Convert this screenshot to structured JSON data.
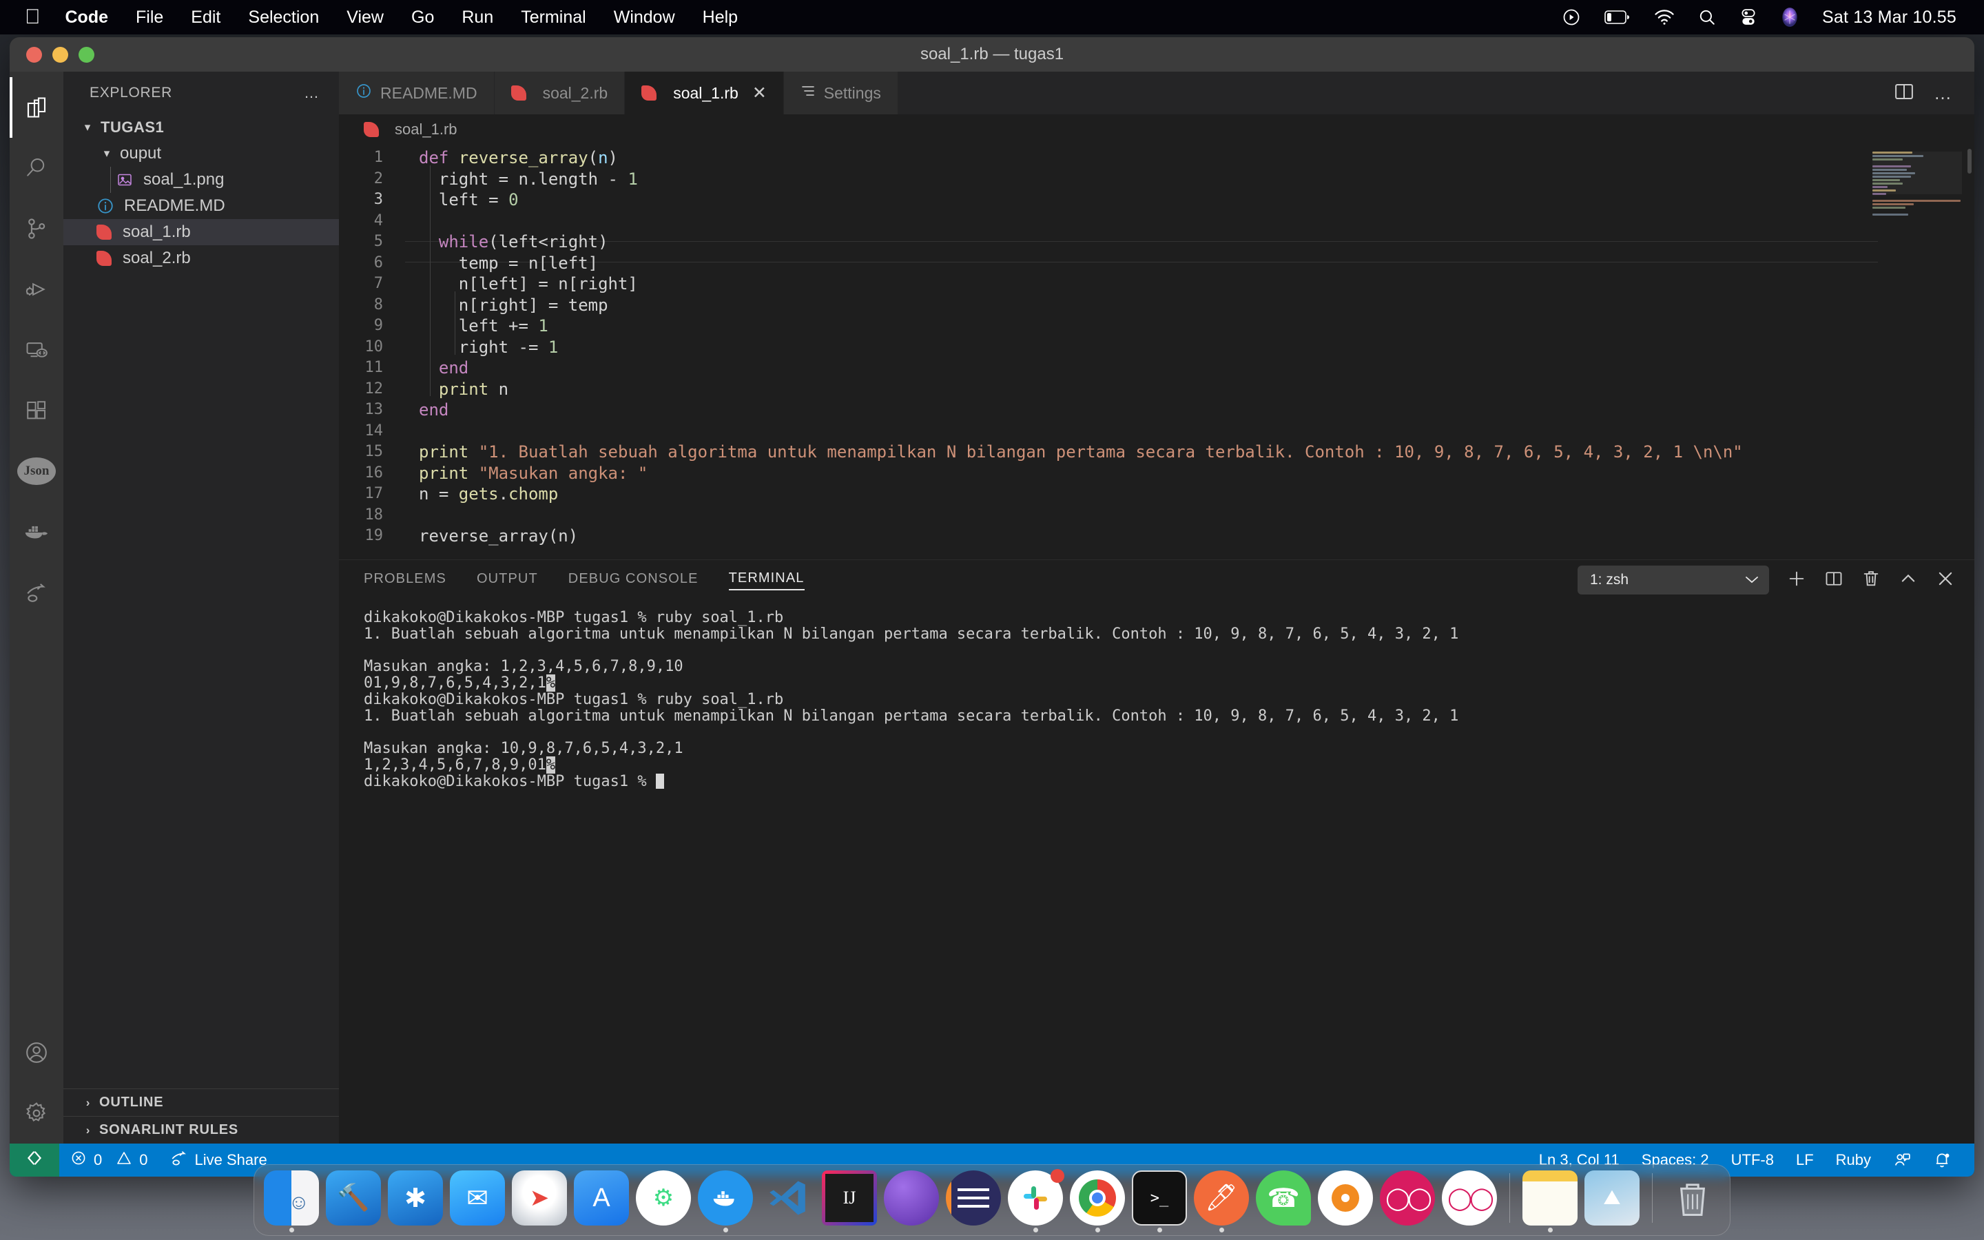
{
  "menubar": {
    "apple_icon": "apple-logo-icon",
    "items": [
      {
        "label": "Code",
        "bold": true
      },
      {
        "label": "File",
        "bold": false
      },
      {
        "label": "Edit",
        "bold": false
      },
      {
        "label": "Selection",
        "bold": false
      },
      {
        "label": "View",
        "bold": false
      },
      {
        "label": "Go",
        "bold": false
      },
      {
        "label": "Run",
        "bold": false
      },
      {
        "label": "Terminal",
        "bold": false
      },
      {
        "label": "Window",
        "bold": false
      },
      {
        "label": "Help",
        "bold": false
      }
    ],
    "status_icons": [
      "screen-record-icon",
      "battery-icon",
      "wifi-icon",
      "search-icon",
      "control-center-icon",
      "siri-icon"
    ],
    "clock": "Sat 13 Mar  10.55"
  },
  "window": {
    "title": "soal_1.rb — tugas1",
    "traffic_lights": [
      "close-button",
      "minimize-button",
      "zoom-button"
    ]
  },
  "activitybar": {
    "items": [
      {
        "name": "explorer",
        "icon": "files-icon",
        "active": true
      },
      {
        "name": "search",
        "icon": "search-icon",
        "active": false
      },
      {
        "name": "source-control",
        "icon": "source-control-icon",
        "active": false
      },
      {
        "name": "run-and-debug",
        "icon": "run-debug-icon",
        "active": false
      },
      {
        "name": "remote-explorer",
        "icon": "remote-monitor-icon",
        "active": false
      },
      {
        "name": "extensions",
        "icon": "extensions-icon",
        "active": false
      },
      {
        "name": "json-tools",
        "icon": "json-icon",
        "label": "Json",
        "active": false
      },
      {
        "name": "docker",
        "icon": "docker-whale-icon",
        "active": false
      },
      {
        "name": "live-share",
        "icon": "live-share-icon",
        "active": false
      }
    ],
    "bottom_items": [
      {
        "name": "accounts",
        "icon": "account-icon"
      },
      {
        "name": "manage",
        "icon": "gear-icon"
      }
    ]
  },
  "sidebar": {
    "title": "EXPLORER",
    "more_actions": "…",
    "tree": [
      {
        "label": "TUGAS1",
        "type": "root",
        "chevron": "▾",
        "indent": 0,
        "selected": false
      },
      {
        "label": "ouput",
        "type": "folder",
        "chevron": "▾",
        "indent": 1,
        "selected": false
      },
      {
        "label": "soal_1.png",
        "type": "image",
        "chevron": "",
        "indent": 2,
        "selected": false
      },
      {
        "label": "README.MD",
        "type": "markdown",
        "chevron": "",
        "indent": 1,
        "selected": false
      },
      {
        "label": "soal_1.rb",
        "type": "ruby",
        "chevron": "",
        "indent": 1,
        "selected": true
      },
      {
        "label": "soal_2.rb",
        "type": "ruby",
        "chevron": "",
        "indent": 1,
        "selected": false
      }
    ],
    "sections": [
      {
        "label": "OUTLINE",
        "chevron": "›"
      },
      {
        "label": "SONARLINT RULES",
        "chevron": "›"
      }
    ]
  },
  "editor": {
    "tabs": [
      {
        "label": "README.MD",
        "icon": "markdown-info-icon",
        "active": false,
        "closable": false
      },
      {
        "label": "soal_2.rb",
        "icon": "ruby-icon",
        "active": false,
        "closable": false
      },
      {
        "label": "soal_1.rb",
        "icon": "ruby-icon",
        "active": true,
        "closable": true,
        "close_glyph": "✕"
      },
      {
        "label": "Settings",
        "icon": "settings-lines-icon",
        "active": false,
        "closable": false
      }
    ],
    "actions": [
      "split-editor-icon",
      "more-actions-icon"
    ],
    "breadcrumb": "soal_1.rb",
    "language": "ruby",
    "lines": [
      {
        "n": 1,
        "indent": 0,
        "tokens": [
          {
            "t": "def ",
            "c": "kw"
          },
          {
            "t": "reverse_array",
            "c": "fn"
          },
          {
            "t": "(",
            "c": "pl"
          },
          {
            "t": "n",
            "c": "param"
          },
          {
            "t": ")",
            "c": "pl"
          }
        ]
      },
      {
        "n": 2,
        "indent": 1,
        "tokens": [
          {
            "t": "right = n.length ",
            "c": "pl"
          },
          {
            "t": "- ",
            "c": "pl"
          },
          {
            "t": "1",
            "c": "num"
          }
        ]
      },
      {
        "n": 3,
        "indent": 1,
        "current": true,
        "tokens": [
          {
            "t": "left = ",
            "c": "pl"
          },
          {
            "t": "0",
            "c": "num"
          }
        ]
      },
      {
        "n": 4,
        "indent": 0,
        "tokens": []
      },
      {
        "n": 5,
        "indent": 1,
        "tokens": [
          {
            "t": "while",
            "c": "kw"
          },
          {
            "t": "(left<right)",
            "c": "pl"
          }
        ]
      },
      {
        "n": 6,
        "indent": 2,
        "tokens": [
          {
            "t": "temp = n[left]",
            "c": "pl"
          }
        ]
      },
      {
        "n": 7,
        "indent": 2,
        "tokens": [
          {
            "t": "n[left] = n[right]",
            "c": "pl"
          }
        ]
      },
      {
        "n": 8,
        "indent": 2,
        "tokens": [
          {
            "t": "n[right] = temp",
            "c": "pl"
          }
        ]
      },
      {
        "n": 9,
        "indent": 2,
        "tokens": [
          {
            "t": "left += ",
            "c": "pl"
          },
          {
            "t": "1",
            "c": "num"
          }
        ]
      },
      {
        "n": 10,
        "indent": 2,
        "tokens": [
          {
            "t": "right -= ",
            "c": "pl"
          },
          {
            "t": "1",
            "c": "num"
          }
        ]
      },
      {
        "n": 11,
        "indent": 1,
        "tokens": [
          {
            "t": "end",
            "c": "kw"
          }
        ]
      },
      {
        "n": 12,
        "indent": 1,
        "tokens": [
          {
            "t": "print",
            "c": "fn"
          },
          {
            "t": " n",
            "c": "pl"
          }
        ]
      },
      {
        "n": 13,
        "indent": 0,
        "tokens": [
          {
            "t": "end",
            "c": "kw"
          }
        ]
      },
      {
        "n": 14,
        "indent": 0,
        "tokens": []
      },
      {
        "n": 15,
        "indent": 0,
        "tokens": [
          {
            "t": "print",
            "c": "fn"
          },
          {
            "t": " ",
            "c": "pl"
          },
          {
            "t": "\"1. Buatlah sebuah algoritma untuk menampilkan N bilangan pertama secara terbalik. Contoh : 10, 9, 8, 7, 6, 5, 4, 3, 2, 1 \\n\\n\"",
            "c": "str"
          }
        ]
      },
      {
        "n": 16,
        "indent": 0,
        "tokens": [
          {
            "t": "print",
            "c": "fn"
          },
          {
            "t": " ",
            "c": "pl"
          },
          {
            "t": "\"Masukan angka: \"",
            "c": "str"
          }
        ]
      },
      {
        "n": 17,
        "indent": 0,
        "tokens": [
          {
            "t": "n = ",
            "c": "pl"
          },
          {
            "t": "gets",
            "c": "fn"
          },
          {
            "t": ".",
            "c": "pl"
          },
          {
            "t": "chomp",
            "c": "fn"
          }
        ]
      },
      {
        "n": 18,
        "indent": 0,
        "tokens": []
      },
      {
        "n": 19,
        "indent": 0,
        "tokens": [
          {
            "t": "reverse_array(n)",
            "c": "pl"
          }
        ]
      }
    ]
  },
  "panel": {
    "tabs": [
      {
        "label": "PROBLEMS",
        "active": false
      },
      {
        "label": "OUTPUT",
        "active": false
      },
      {
        "label": "DEBUG CONSOLE",
        "active": false
      },
      {
        "label": "TERMINAL",
        "active": true
      }
    ],
    "shell_selector": {
      "value": "1: zsh",
      "chevron": "⌄"
    },
    "actions": [
      "new-terminal-icon",
      "split-terminal-icon",
      "kill-terminal-icon",
      "maximize-panel-icon",
      "close-panel-icon"
    ],
    "terminal_lines": [
      {
        "text": "dikakoko@Dikakokos-MBP tugas1 % ruby soal_1.rb"
      },
      {
        "text": "1. Buatlah sebuah algoritma untuk menampilkan N bilangan pertama secara terbalik. Contoh : 10, 9, 8, 7, 6, 5, 4, 3, 2, 1"
      },
      {
        "text": ""
      },
      {
        "text": "Masukan angka: 1,2,3,4,5,6,7,8,9,10"
      },
      {
        "text": "01,9,8,7,6,5,4,3,2,1",
        "reverse_suffix": "%"
      },
      {
        "text": "dikakoko@Dikakokos-MBP tugas1 % ruby soal_1.rb"
      },
      {
        "text": "1. Buatlah sebuah algoritma untuk menampilkan N bilangan pertama secara terbalik. Contoh : 10, 9, 8, 7, 6, 5, 4, 3, 2, 1"
      },
      {
        "text": ""
      },
      {
        "text": "Masukan angka: 10,9,8,7,6,5,4,3,2,1"
      },
      {
        "text": "1,2,3,4,5,6,7,8,9,01",
        "reverse_suffix": "%"
      },
      {
        "text": "dikakoko@Dikakokos-MBP tugas1 % ",
        "cursor": true
      }
    ]
  },
  "statusbar": {
    "remote_icon": "remote-window-icon",
    "errors": "0",
    "warnings": "0",
    "live_share": "Live Share",
    "position": "Ln 3, Col 11",
    "spaces": "Spaces: 2",
    "encoding": "UTF-8",
    "eol": "LF",
    "language": "Ruby",
    "right_icons": [
      "account-share-icon",
      "bell-dot-icon"
    ],
    "accent_color": "#007acc",
    "remote_color": "#16825d"
  },
  "dock": {
    "items": [
      {
        "name": "finder",
        "running": true
      },
      {
        "name": "xcode",
        "running": false
      },
      {
        "name": "xcode-beta",
        "running": false
      },
      {
        "name": "mail",
        "running": false
      },
      {
        "name": "safari",
        "running": false
      },
      {
        "name": "app-store",
        "running": false
      },
      {
        "name": "android-studio",
        "running": false
      },
      {
        "name": "docker",
        "running": true
      },
      {
        "name": "visual-studio-code",
        "running": false
      },
      {
        "name": "intellij-idea",
        "running": false
      },
      {
        "name": "postman",
        "running": false
      },
      {
        "name": "figma",
        "running": false
      },
      {
        "name": "slack",
        "running": true,
        "badge": true
      },
      {
        "name": "google-chrome",
        "running": true
      },
      {
        "name": "terminal",
        "running": true
      },
      {
        "name": "postman-alt",
        "running": true
      },
      {
        "name": "whatsapp",
        "running": false
      },
      {
        "name": "sourcetree",
        "running": false
      },
      {
        "name": "flutter-a",
        "running": false
      },
      {
        "name": "flutter-b",
        "running": false
      },
      {
        "name": "notes",
        "running": true
      },
      {
        "name": "photos",
        "running": false
      },
      {
        "name": "trash",
        "running": false
      }
    ]
  }
}
